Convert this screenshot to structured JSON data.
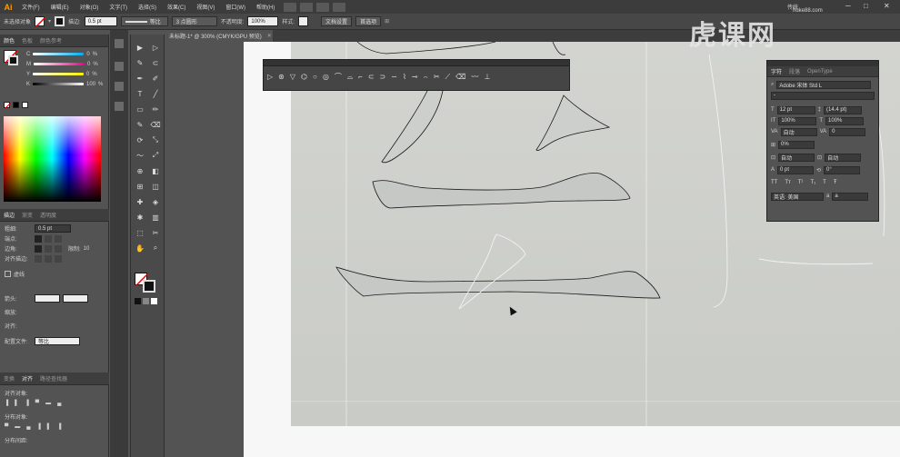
{
  "app": {
    "logo": "Ai",
    "menus": [
      "文件(F)",
      "编辑(E)",
      "对象(O)",
      "文字(T)",
      "选择(S)",
      "效果(C)",
      "视图(V)",
      "窗口(W)",
      "帮助(H)"
    ],
    "workspace": "传统"
  },
  "control_bar": {
    "selection_label": "未选择对象",
    "stroke_label": "描边:",
    "stroke_value": "0.5 pt",
    "stroke_style": "等比",
    "brush_label": "3 点圆形",
    "opacity_label": "不透明度:",
    "opacity_value": "100%",
    "style_label": "样式:",
    "doc_setup": "文档设置",
    "preferences": "首选项"
  },
  "document": {
    "tab_title": "未标题-1* @ 300% (CMYK/GPU 预览)"
  },
  "color_panel": {
    "tabs": [
      "颜色",
      "色板",
      "颜色参考"
    ],
    "rows": [
      {
        "label": "C",
        "value": "0",
        "unit": "%"
      },
      {
        "label": "M",
        "value": "0",
        "unit": "%"
      },
      {
        "label": "Y",
        "value": "0",
        "unit": "%"
      },
      {
        "label": "K",
        "value": "100",
        "unit": "%"
      }
    ]
  },
  "stroke_panel": {
    "tabs": [
      "描边",
      "渐变",
      "透明度"
    ],
    "weight_label": "粗细:",
    "weight_value": "0.5 pt",
    "cap_label": "端点:",
    "corner_label": "边角:",
    "limit_label": "限制:",
    "limit_value": "10",
    "align_label": "对齐描边:",
    "dashed_label": "虚线",
    "arrow_label": "箭头:",
    "scale_label": "缩放:",
    "align_arrow_label": "对齐:",
    "profile_label": "配置文件:",
    "profile_value": "等比"
  },
  "align_panel": {
    "tabs": [
      "变换",
      "对齐",
      "路径查找器"
    ],
    "align_objects": "对齐对象:",
    "distribute_objects": "分布对象:",
    "distribute_spacing": "分布间距:"
  },
  "char_panel": {
    "tabs": [
      "字符",
      "段落",
      "OpenType"
    ],
    "font": "Adobe 宋体 Std L",
    "font_style": "-",
    "size": "12 pt",
    "leading": "(14.4 pt)",
    "vscale": "100%",
    "hscale": "100%",
    "kerning": "自动",
    "tracking": "0",
    "tsume": "0%",
    "aki_left": "自动",
    "aki_right": "自动",
    "baseline": "0 pt",
    "rotation": "0°",
    "language": "英语: 美国",
    "aa": "a"
  },
  "watermark": {
    "text": "虎课网",
    "url": "huke88.com"
  }
}
